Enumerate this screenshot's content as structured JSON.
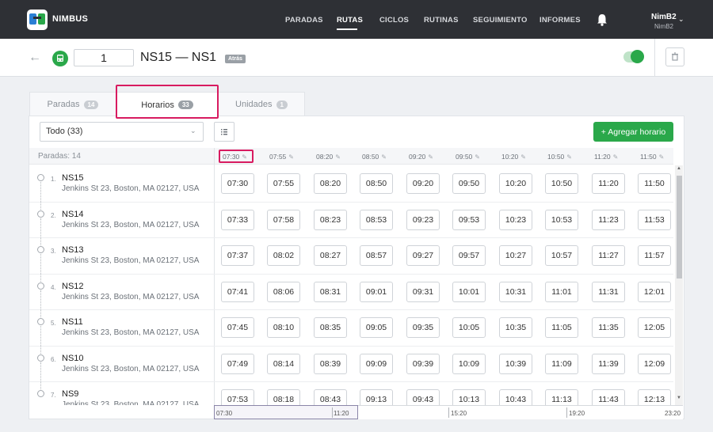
{
  "app": {
    "brand": "NIMBUS"
  },
  "nav": {
    "items": [
      "PARADAS",
      "RUTAS",
      "CICLOS",
      "RUTINAS",
      "SEGUIMIENTO",
      "INFORMES"
    ],
    "active": "RUTAS"
  },
  "user": {
    "name": "NimB2",
    "sub": "NimB2"
  },
  "route": {
    "number": "1",
    "title": "NS15 — NS1",
    "direction_badge": "Atrás",
    "enabled": true
  },
  "tabs": [
    {
      "label": "Paradas",
      "count": "14"
    },
    {
      "label": "Horarios",
      "count": "33"
    },
    {
      "label": "Unidades",
      "count": "1"
    }
  ],
  "filter": {
    "selected": "Todo (33)"
  },
  "add_button": "+ Agregar horario",
  "stops_header": "Paradas: 14",
  "columns": [
    "07:30",
    "07:55",
    "08:20",
    "08:50",
    "09:20",
    "09:50",
    "10:20",
    "10:50",
    "11:20",
    "11:50"
  ],
  "stops": [
    {
      "idx": "1.",
      "name": "NS15",
      "addr": "Jenkins St 23, Boston, MA 02127, USA",
      "times": [
        "07:30",
        "07:55",
        "08:20",
        "08:50",
        "09:20",
        "09:50",
        "10:20",
        "10:50",
        "11:20",
        "11:50"
      ]
    },
    {
      "idx": "2.",
      "name": "NS14",
      "addr": "Jenkins St 23, Boston, MA 02127, USA",
      "times": [
        "07:33",
        "07:58",
        "08:23",
        "08:53",
        "09:23",
        "09:53",
        "10:23",
        "10:53",
        "11:23",
        "11:53"
      ]
    },
    {
      "idx": "3.",
      "name": "NS13",
      "addr": "Jenkins St 23, Boston, MA 02127, USA",
      "times": [
        "07:37",
        "08:02",
        "08:27",
        "08:57",
        "09:27",
        "09:57",
        "10:27",
        "10:57",
        "11:27",
        "11:57"
      ]
    },
    {
      "idx": "4.",
      "name": "NS12",
      "addr": "Jenkins St 23, Boston, MA 02127, USA",
      "times": [
        "07:41",
        "08:06",
        "08:31",
        "09:01",
        "09:31",
        "10:01",
        "10:31",
        "11:01",
        "11:31",
        "12:01"
      ]
    },
    {
      "idx": "5.",
      "name": "NS11",
      "addr": "Jenkins St 23, Boston, MA 02127, USA",
      "times": [
        "07:45",
        "08:10",
        "08:35",
        "09:05",
        "09:35",
        "10:05",
        "10:35",
        "11:05",
        "11:35",
        "12:05"
      ]
    },
    {
      "idx": "6.",
      "name": "NS10",
      "addr": "Jenkins St 23, Boston, MA 02127, USA",
      "times": [
        "07:49",
        "08:14",
        "08:39",
        "09:09",
        "09:39",
        "10:09",
        "10:39",
        "11:09",
        "11:39",
        "12:09"
      ]
    },
    {
      "idx": "7.",
      "name": "NS9",
      "addr": "Jenkins St 23, Boston, MA 02127, USA",
      "times": [
        "07:53",
        "08:18",
        "08:43",
        "09:13",
        "09:43",
        "10:13",
        "10:43",
        "11:13",
        "11:43",
        "12:13"
      ]
    }
  ],
  "timeline": {
    "labels": [
      "07:30",
      "11:20",
      "15:20",
      "19:20",
      "23:20"
    ]
  },
  "colors": {
    "topbar": "#2e3035",
    "accent": "#2aa84a",
    "highlight": "#d81b60"
  },
  "icons": [
    "app-logo-icon",
    "bell-icon",
    "back-arrow-icon",
    "bus-icon",
    "trash-icon",
    "list-icon",
    "pencil-icon"
  ]
}
